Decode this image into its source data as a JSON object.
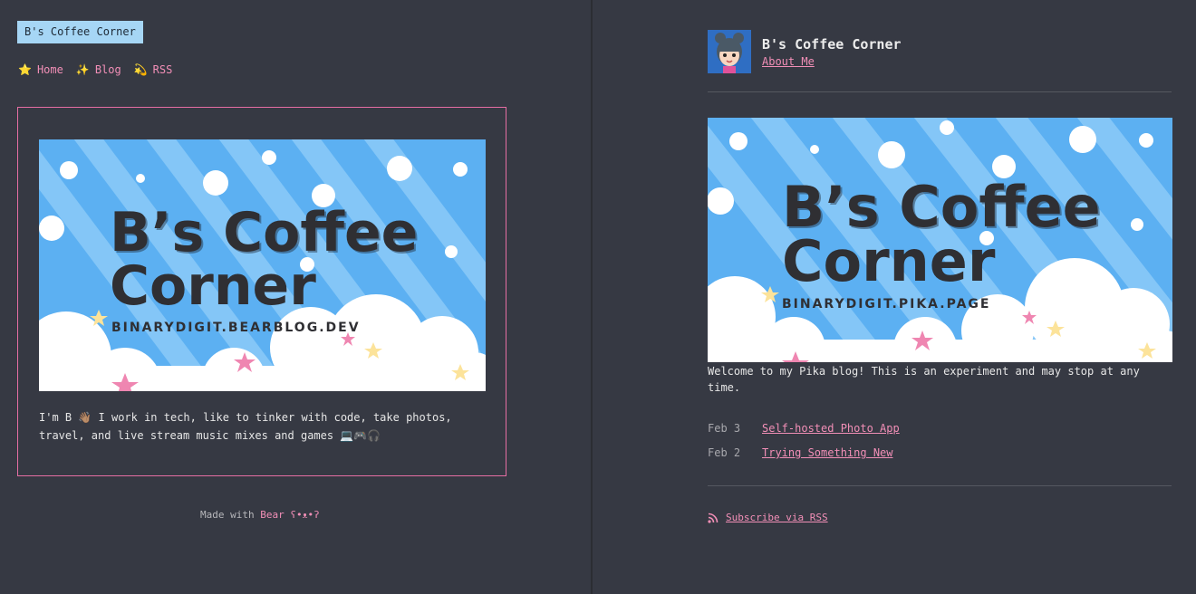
{
  "bear": {
    "title": "B's Coffee Corner",
    "nav": [
      {
        "icon": "star-icon",
        "glyph": "⭐",
        "label": "Home"
      },
      {
        "icon": "sparkles-icon",
        "glyph": "✨",
        "label": "Blog"
      },
      {
        "icon": "dizzy-icon",
        "glyph": "💫",
        "label": "RSS"
      }
    ],
    "banner": {
      "title_line1": "B’s Coffee",
      "title_line2": "Corner",
      "domain": "BINARYDIGIT.BEARBLOG.DEV"
    },
    "intro": "I'm B 👋🏽 I work in tech, like to tinker with code, take photos, travel, and live stream music mixes and games 💻🎮🎧",
    "footer": {
      "prefix": "Made with ",
      "link": "Bear ʕ•ᴥ•ʔ"
    }
  },
  "pika": {
    "title": "B's Coffee Corner",
    "about": "About Me",
    "banner": {
      "title_line1": "B’s Coffee",
      "title_line2": "Corner",
      "domain": "BINARYDIGIT.PIKA.PAGE"
    },
    "welcome": "Welcome to my Pika blog! This is an experiment and may stop at any time.",
    "posts": [
      {
        "date": "Feb 3",
        "title": "Self-hosted Photo App"
      },
      {
        "date": "Feb 2",
        "title": "Trying Something New"
      }
    ],
    "rss": "Subscribe via RSS"
  },
  "colors": {
    "background": "#363943",
    "accent_pink": "#f28fb7",
    "title_bg": "#a6d6f5",
    "banner_blue": "#5cb0f2"
  }
}
